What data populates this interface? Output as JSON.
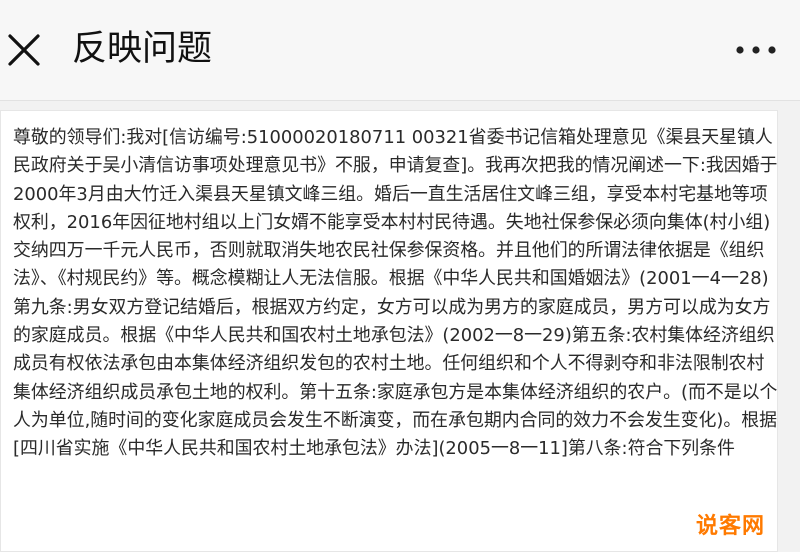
{
  "header": {
    "title": "反映问题",
    "close_icon": "close-icon",
    "more_icon": "more-dots-icon"
  },
  "content": {
    "text": "尊敬的领导们:我对[信访编号:51000020180711 00321省委书记信箱处理意见《渠县天星镇人民政府关于吴小清信访事项处理意见书》不服，申请复查]。我再次把我的情况阐述一下:我因婚于2000年3月由大竹迁入渠县天星镇文峰三组。婚后一直生活居住文峰三组，享受本村宅基地等项权利，2016年因征地村组以上门女婿不能享受本村村民待遇。失地社保参保必须向集体(村小组)交纳四万一千元人民币，否则就取消失地农民社保参保资格。并且他们的所谓法律依据是《组织法》、《村规民约》等。概念模糊让人无法信服。根据《中华人民共和国婚姻法》(2001一4一28)第九条:男女双方登记结婚后，根据双方约定，女方可以成为男方的家庭成员，男方可以成为女方的家庭成员。根据《中华人民共和国农村土地承包法》(2002一8一29)第五条:农村集体经济组织成员有权依法承包由本集体经济组织发包的农村土地。任何组织和个人不得剥夺和非法限制农村集体经济组织成员承包土地的权利。第十五条:家庭承包方是本集体经济组织的农户。(而不是以个人为单位,随时间的变化家庭成员会发生不断演变，而在承包期内合同的效力不会发生变化)。根据[四川省实施《中华人民共和国农村土地承包法》办法](2005一8一11]第八条:符合下列条件",
    "watermark": "说客网"
  },
  "colors": {
    "header_bg": "#f7f7f7",
    "page_bg": "#f2f2f2",
    "text": "#2a2a2a",
    "watermark": "#ff7a00"
  }
}
